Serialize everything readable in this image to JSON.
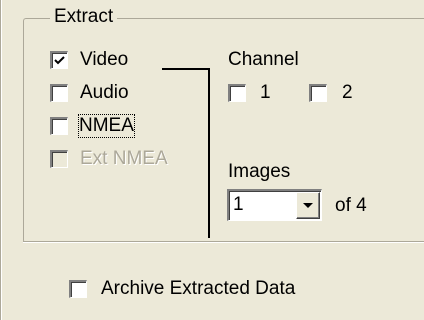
{
  "extract_group": {
    "title": "Extract",
    "options": [
      {
        "label": "Video",
        "checked": true,
        "enabled": true
      },
      {
        "label": "Audio",
        "checked": false,
        "enabled": true
      },
      {
        "label": "NMEA",
        "checked": false,
        "enabled": true,
        "focused": true
      },
      {
        "label": "Ext NMEA",
        "checked": false,
        "enabled": false
      }
    ],
    "channel": {
      "label": "Channel",
      "options": [
        {
          "label": "1",
          "checked": false
        },
        {
          "label": "2",
          "checked": false
        }
      ]
    },
    "images": {
      "label": "Images",
      "selected": "1",
      "of_text": "of 4"
    }
  },
  "archive": {
    "label": "Archive Extracted Data",
    "checked": false
  }
}
